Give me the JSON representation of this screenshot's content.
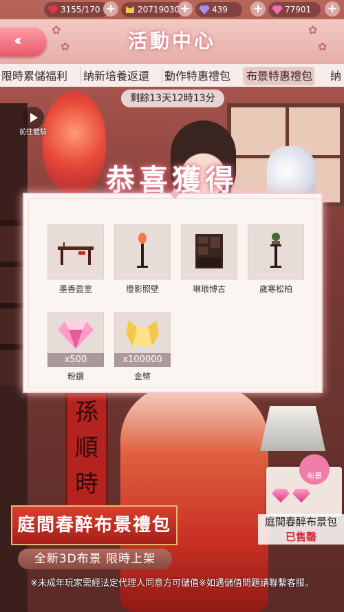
{
  "resources": [
    {
      "icon": "heart-icon",
      "value": "3155/170",
      "color": "#e8344a"
    },
    {
      "icon": "cat-coin-icon",
      "value": "20719030",
      "color": "#f2c94c"
    },
    {
      "icon": "diamond-icon",
      "value": "439",
      "color": "#a98cf0"
    },
    {
      "icon": "pink-diamond-icon",
      "value": "77901",
      "color": "#f06fa9"
    }
  ],
  "header": {
    "title": "活動中心"
  },
  "tabs": [
    {
      "label": "限時累儲福利",
      "active": false
    },
    {
      "label": "納新培養返還",
      "active": false
    },
    {
      "label": "動作特惠禮包",
      "active": false
    },
    {
      "label": "布景特惠禮包",
      "active": true
    },
    {
      "label": "納",
      "active": false
    }
  ],
  "timer": "剩餘13天12時13分",
  "trial_button": "前往體驗",
  "popup": {
    "title": "恭喜獲得",
    "items": [
      {
        "name": "墨香盈室",
        "icon": "writing-desk-icon",
        "qty": ""
      },
      {
        "name": "燈影照壁",
        "icon": "standing-lamp-icon",
        "qty": ""
      },
      {
        "name": "琳琅博古",
        "icon": "curio-cabinet-icon",
        "qty": ""
      },
      {
        "name": "歲寒松柏",
        "icon": "bonsai-stand-icon",
        "qty": ""
      },
      {
        "name": "粉鑽",
        "icon": "pink-diamond-icon",
        "qty": "x500"
      },
      {
        "name": "金幣",
        "icon": "gold-cat-coin-icon",
        "qty": "x100000"
      }
    ]
  },
  "couplet": [
    "孫",
    "順",
    "時"
  ],
  "promo": {
    "title": "庭間春醉布景禮包",
    "subtitle": "全新3D布景 限時上架"
  },
  "pack": {
    "badge": "布景",
    "name": "庭間春醉布景包",
    "status": "已售罄"
  },
  "notice": "※未成年玩家需經法定代理人同意方可儲值※如遇儲值問題請聯繫客服。",
  "accent_color": "#e85a6b"
}
